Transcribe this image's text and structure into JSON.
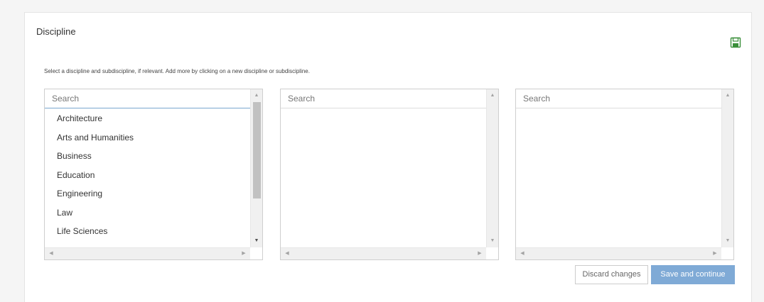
{
  "section": {
    "title": "Discipline",
    "hint": "Select a discipline and subdiscipline, if relevant. Add more by clicking on a new discipline or subdiscipline."
  },
  "lists": [
    {
      "placeholder": "Search",
      "items": [
        "Architecture",
        "Arts and Humanities",
        "Business",
        "Education",
        "Engineering",
        "Law",
        "Life Sciences"
      ]
    },
    {
      "placeholder": "Search",
      "items": []
    },
    {
      "placeholder": "Search",
      "items": []
    }
  ],
  "icons": {
    "save": "save-icon",
    "scroll_up": "chevron-up-icon",
    "scroll_down": "chevron-down-icon",
    "scroll_left": "chevron-left-icon",
    "scroll_right": "chevron-right-icon"
  },
  "buttons": {
    "discard": "Discard changes",
    "save": "Save and continue"
  },
  "colors": {
    "primary": "#7faad6",
    "save_icon": "#3a8f3a",
    "focus_border": "#7aa7cf"
  }
}
